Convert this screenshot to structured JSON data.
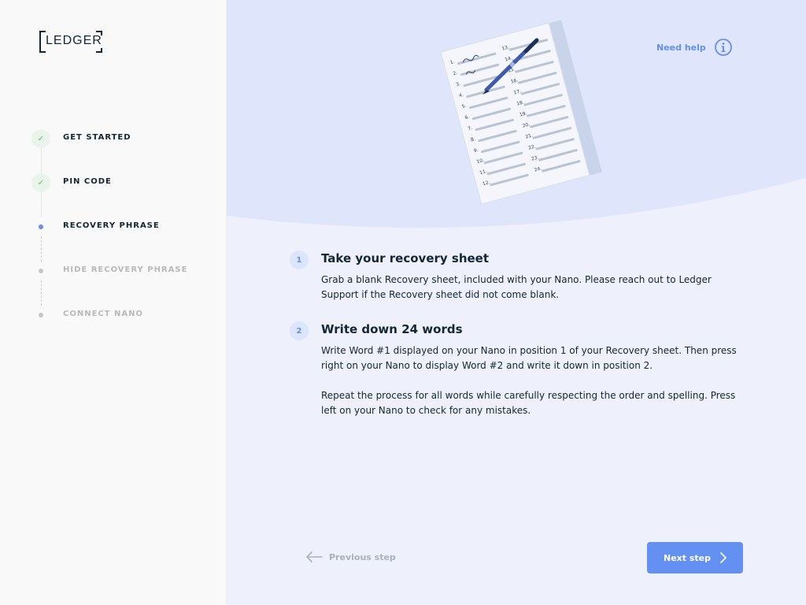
{
  "brand": {
    "logo_text": "LEDGER"
  },
  "steps": [
    {
      "label": "GET STARTED",
      "status": "done"
    },
    {
      "label": "PIN CODE",
      "status": "done"
    },
    {
      "label": "RECOVERY PHRASE",
      "status": "active"
    },
    {
      "label": "HIDE RECOVERY PHRASE",
      "status": "pending"
    },
    {
      "label": "CONNECT NANO",
      "status": "pending"
    }
  ],
  "header": {
    "help_label": "Need help"
  },
  "illustration": {
    "sheet_numbers": [
      "1.",
      "2.",
      "3.",
      "4.",
      "5.",
      "6.",
      "7.",
      "8.",
      "9.",
      "10.",
      "11.",
      "12.",
      "13.",
      "14.",
      "15.",
      "16.",
      "17.",
      "18.",
      "19.",
      "20.",
      "21.",
      "22.",
      "23.",
      "24."
    ]
  },
  "instructions": [
    {
      "number": "1",
      "title": "Take your recovery sheet",
      "paragraphs": [
        "Grab a blank Recovery sheet, included with your Nano. Please reach out to Ledger Support if the Recovery sheet did not come blank."
      ]
    },
    {
      "number": "2",
      "title": "Write down 24 words",
      "paragraphs": [
        "Write Word #1 displayed on your Nano in position 1 of your Recovery sheet. Then press right on your Nano to display Word #2 and write it down in position 2.",
        "Repeat the process for all words while carefully respecting the order and spelling. Press left on your Nano to check for any mistakes."
      ]
    }
  ],
  "footer": {
    "previous_label": "Previous step",
    "next_label": "Next step"
  },
  "colors": {
    "accent": "#6490f1",
    "done_green": "#66be54",
    "text_dark": "#142533",
    "text_muted": "#b9b9b9",
    "sidebar_bg": "#f9f9f9",
    "main_bg": "#eef1fb",
    "hero_bg": "#dfe6fb"
  }
}
